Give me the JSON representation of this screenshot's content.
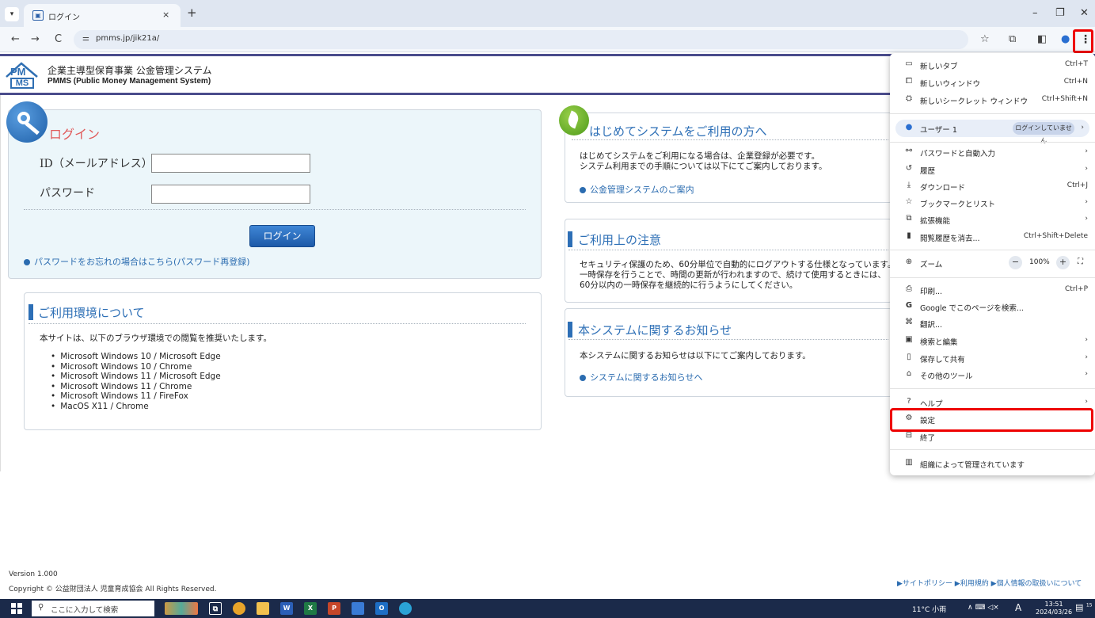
{
  "browser": {
    "tab_title": "ログイン",
    "tab_favicon": "▣",
    "tab_close": "×",
    "new_tab": "+",
    "tab_dropdown": "▾",
    "win_min": "–",
    "win_max": "❐",
    "win_close": "✕",
    "back": "←",
    "forward": "→",
    "reload": "C",
    "site_info": "⚌",
    "url": "pmms.jp/jik21a/",
    "bookmark_star": "☆",
    "extensions": "⧉",
    "sidepanel": "◧",
    "profile": "●",
    "menu_kebab": "⋮"
  },
  "header": {
    "logo_pm": "PM",
    "logo_ms": "MS",
    "title": "企業主導型保育事業 公金管理システム",
    "subtitle": "PMMS (Public Money Management System)"
  },
  "login": {
    "title": "ログイン",
    "id_label": "ID（メールアドレス）",
    "id_value": "",
    "password_label": "パスワード",
    "password_value": "",
    "button": "ログイン",
    "forgot_link": "パスワードをお忘れの場合はこちら(パスワード再登録)"
  },
  "environment": {
    "title": "ご利用環境について",
    "intro": "本サイトは、以下のブラウザ環境での閲覧を推奨いたします。",
    "items": [
      "Microsoft Windows 10 / Microsoft Edge",
      "Microsoft Windows 10 / Chrome",
      "Microsoft Windows 11 / Microsoft Edge",
      "Microsoft Windows 11 / Chrome",
      "Microsoft Windows 11 / FireFox",
      "MacOS X11 / Chrome"
    ]
  },
  "first_time": {
    "title": "はじめてシステムをご利用の方へ",
    "line1": "はじめてシステムをご利用になる場合は、企業登録が必要です。",
    "line2": "システム利用までの手順については以下にてご案内しております。",
    "link": "公金管理システムのご案内"
  },
  "notice": {
    "title": "ご利用上の注意",
    "line1": "セキュリティ保護のため、60分単位で自動的にログアウトする仕様となっています。",
    "line2": "一時保存を行うことで、時間の更新が行われますので、続けて使用するときには、",
    "line3": "60分以内の一時保存を継続的に行うようにしてください。"
  },
  "news": {
    "title": "本システムに関するお知らせ",
    "line1": "本システムに関するお知らせは以下にてご案内しております。",
    "link": "システムに関するお知らせへ"
  },
  "footer": {
    "version": "Version 1.000",
    "copyright": "Copyright © 公益財団法人 児童育成協会 All Rights Reserved.",
    "links": "▶サイトポリシー ▶利用規約 ▶個人情報の取扱いについて"
  },
  "menu": {
    "new_tab": {
      "icon": "▭",
      "label": "新しいタブ",
      "shortcut": "Ctrl+T"
    },
    "new_window": {
      "icon": "⧠",
      "label": "新しいウィンドウ",
      "shortcut": "Ctrl+N"
    },
    "incognito": {
      "icon": "⛭",
      "label": "新しいシークレット ウィンドウ",
      "shortcut": "Ctrl+Shift+N"
    },
    "user": {
      "icon": "●",
      "label": "ユーザー 1",
      "status": "ログインしていません",
      "arrow": "›"
    },
    "passwords": {
      "icon": "⚯",
      "label": "パスワードと自動入力",
      "arrow": "›"
    },
    "history": {
      "icon": "↺",
      "label": "履歴",
      "arrow": "›"
    },
    "downloads": {
      "icon": "⤓",
      "label": "ダウンロード",
      "shortcut": "Ctrl+J"
    },
    "bookmarks": {
      "icon": "☆",
      "label": "ブックマークとリスト",
      "arrow": "›"
    },
    "extensions": {
      "icon": "⧉",
      "label": "拡張機能",
      "arrow": "›"
    },
    "clear_history": {
      "icon": "▮",
      "label": "閲覧履歴を消去...",
      "shortcut": "Ctrl+Shift+Delete"
    },
    "zoom": {
      "icon": "⊕",
      "label": "ズーム",
      "minus": "−",
      "value": "100%",
      "plus": "+",
      "fullscreen": "⛶"
    },
    "print": {
      "icon": "⎙",
      "label": "印刷...",
      "shortcut": "Ctrl+P"
    },
    "google_search": {
      "icon": "G",
      "label": "Google でこのページを検索..."
    },
    "translate": {
      "icon": "⌘",
      "label": "翻訳..."
    },
    "search_edit": {
      "icon": "▣",
      "label": "検索と編集",
      "arrow": "›"
    },
    "save_share": {
      "icon": "▯",
      "label": "保存して共有",
      "arrow": "›"
    },
    "more_tools": {
      "icon": "⌂",
      "label": "その他のツール",
      "arrow": "›"
    },
    "help": {
      "icon": "?",
      "label": "ヘルプ",
      "arrow": "›"
    },
    "settings": {
      "icon": "⚙",
      "label": "設定"
    },
    "exit": {
      "icon": "⊟",
      "label": "終了"
    },
    "managed": {
      "icon": "▥",
      "label": "組織によって管理されています"
    }
  },
  "taskbar": {
    "search_icon": "⚲",
    "search_placeholder": "ここに入力して検索",
    "weather": "11°C 小雨",
    "tray_icons": "∧ ⌨ ◁×",
    "ime": "A",
    "time": "13:51",
    "date": "2024/03/26",
    "notification_icon": "▤",
    "notification_count": "15",
    "task_view_icon": "⧉"
  }
}
